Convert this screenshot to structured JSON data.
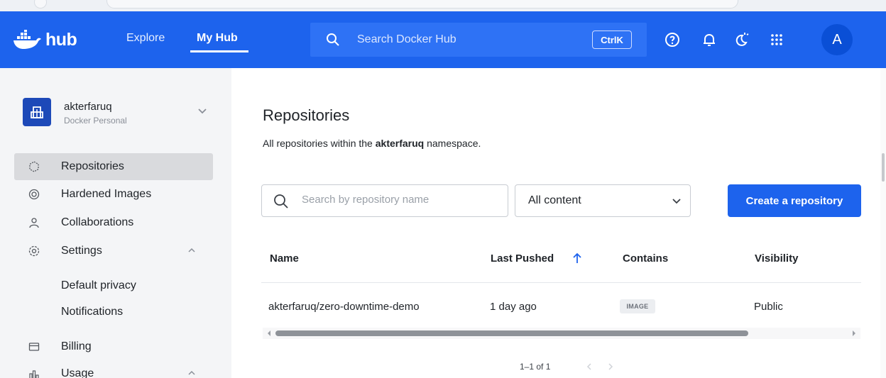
{
  "header": {
    "logo_text": "hub",
    "nav": {
      "explore": "Explore",
      "my_hub": "My Hub"
    },
    "search_placeholder": "Search Docker Hub",
    "shortcut": "CtrlK",
    "icons": [
      "help-circle-icon",
      "bell-icon",
      "theme-toggle-icon",
      "apps-grid-icon"
    ],
    "avatar_letter": "A",
    "brand_color": "#1d63ed"
  },
  "sidebar": {
    "org_name": "akterfaruq",
    "org_type": "Docker Personal",
    "items": [
      {
        "label": "Repositories",
        "icon": "repositories-icon",
        "active": true
      },
      {
        "label": "Hardened Images",
        "icon": "hardened-images-icon"
      },
      {
        "label": "Collaborations",
        "icon": "collaborations-icon"
      },
      {
        "label": "Settings",
        "icon": "settings-icon",
        "expanded": true
      },
      {
        "label": "Billing",
        "icon": "billing-icon"
      },
      {
        "label": "Usage",
        "icon": "usage-icon",
        "expanded": true
      }
    ],
    "settings_sub": [
      "Default privacy",
      "Notifications"
    ]
  },
  "main": {
    "title": "Repositories",
    "subtitle_prefix": "All repositories within the ",
    "namespace": "akterfaruq",
    "subtitle_suffix": " namespace.",
    "search_placeholder": "Search by repository name",
    "filter_selected": "All content",
    "create_button": "Create a repository",
    "columns": [
      "Name",
      "Last Pushed",
      "Contains",
      "Visibility"
    ],
    "sort": {
      "column": "Last Pushed",
      "direction": "ascending"
    },
    "rows": [
      {
        "name": "akterfaruq/zero-downtime-demo",
        "last_pushed": "1 day ago",
        "contains": "IMAGE",
        "visibility": "Public"
      }
    ],
    "pagination": "1–1 of 1"
  }
}
